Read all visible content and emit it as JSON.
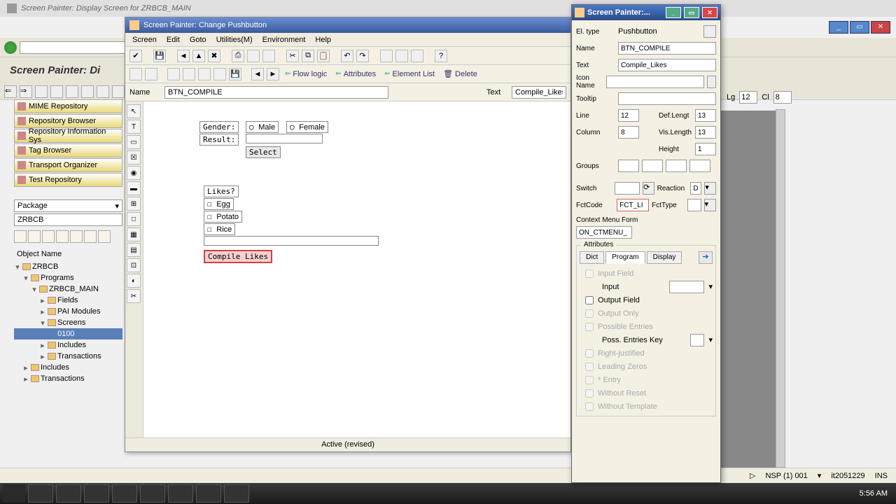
{
  "main_window": {
    "title": "Screen Painter: Display Screen for ZRBCB_MAIN",
    "section_title": "Screen Painter: Di"
  },
  "left_nav": {
    "items": [
      "MIME Repository",
      "Repository Browser",
      "Repository Information Sys",
      "Tag Browser",
      "Transport Organizer",
      "Test Repository"
    ],
    "package_label": "Package",
    "package_value": "ZRBCB",
    "object_name_header": "Object Name",
    "tree": {
      "root": "ZRBCB",
      "programs": "Programs",
      "main": "ZRBCB_MAIN",
      "fields": "Fields",
      "pai": "PAI Modules",
      "screens": "Screens",
      "screen0100": "0100",
      "includes": "Includes",
      "transactions": "Transactions",
      "includes2": "Includes",
      "transactions2": "Transactions"
    }
  },
  "editor": {
    "title": "Screen Painter:  Change Pushbutton",
    "menu": [
      "Screen",
      "Edit",
      "Goto",
      "Utilities(M)",
      "Environment",
      "Help"
    ],
    "toolbar_links": {
      "flow": "Flow logic",
      "attrs": "Attributes",
      "elist": "Element List",
      "delete": "Delete"
    },
    "name_label": "Name",
    "name_value": "BTN_COMPILE",
    "text_label": "Text",
    "text_value": "Compile_Likes",
    "form": {
      "gender_label": "Gender:",
      "male": "Male",
      "female": "Female",
      "result_label": "Result:",
      "select_btn": "Select",
      "likes_label": "Likes?",
      "opt1": "Egg",
      "opt2": "Potato",
      "opt3": "Rice",
      "compile_btn": "Compile Likes"
    },
    "status": "Active (revised)"
  },
  "props": {
    "title": "Screen Painter:...",
    "el_type_label": "El. type",
    "el_type_value": "Pushbutton",
    "name_label": "Name",
    "name_value": "BTN_COMPILE",
    "text_label": "Text",
    "text_value": "Compile_Likes",
    "icon_label": "Icon Name",
    "tooltip_label": "Tooltip",
    "line_label": "Line",
    "line_value": "12",
    "deflen_label": "Def.Lengt",
    "deflen_value": "13",
    "col_label": "Column",
    "col_value": "8",
    "vislen_label": "Vis.Length",
    "vislen_value": "13",
    "height_label": "Height",
    "height_value": "1",
    "groups_label": "Groups",
    "switch_label": "Switch",
    "reaction_label": "Reaction",
    "reaction_value": "D",
    "fctcode_label": "FctCode",
    "fctcode_value": "FCT_LI",
    "fcttype_label": "FctType",
    "ctxmenu_label": "Context Menu Form",
    "ctxmenu_value": "ON_CTMENU_",
    "attrs_legend": "Attributes",
    "tabs": [
      "Dict",
      "Program",
      "Display"
    ],
    "checks": {
      "input_field": "Input Field",
      "input": "Input",
      "output_field": "Output Field",
      "output_only": "Output Only",
      "poss_entries": "Possible Entries",
      "poss_key": "Poss. Entries Key",
      "right_just": "Right-justified",
      "lead_zero": "Leading Zeros",
      "entry": "* Entry",
      "no_reset": "Without Reset",
      "no_tmpl": "Without Template"
    }
  },
  "status_bar": {
    "sys": "NSP (1) 001",
    "user": "it2051229",
    "mode": "INS"
  },
  "ext": {
    "lg": "Lg",
    "lg_val": "12",
    "cl": "Cl",
    "cl_val": "8"
  },
  "taskbar": {
    "time": "5:56 AM"
  }
}
